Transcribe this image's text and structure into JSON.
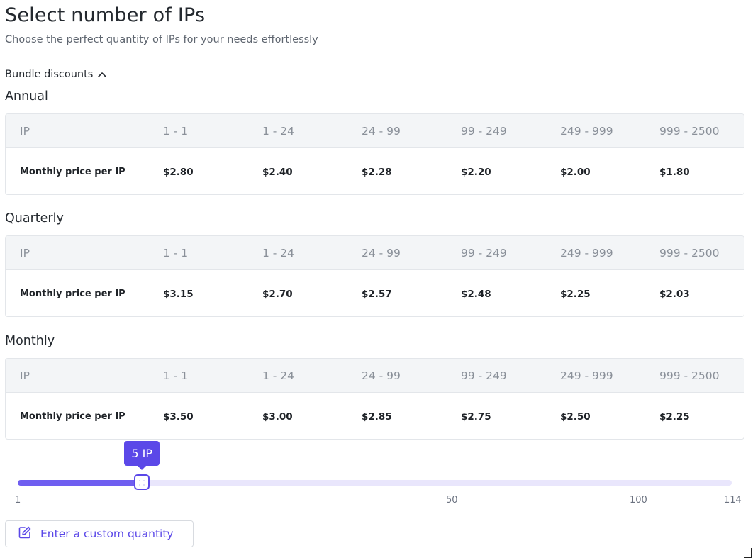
{
  "header": {
    "title": "Select number of IPs",
    "subtitle": "Choose the perfect quantity of IPs for your needs effortlessly",
    "bundle_toggle_label": "Bundle discounts",
    "bundle_toggle_icon": "chevron-up-icon"
  },
  "plans": [
    {
      "name": "Annual",
      "header": [
        "IP",
        "1 - 1",
        "1 - 24",
        "24 - 99",
        "99 - 249",
        "249 - 999",
        "999 - 2500"
      ],
      "row": [
        "Monthly price per IP",
        "$2.80",
        "$2.40",
        "$2.28",
        "$2.20",
        "$2.00",
        "$1.80"
      ]
    },
    {
      "name": "Quarterly",
      "header": [
        "IP",
        "1 - 1",
        "1 - 24",
        "24 - 99",
        "99 - 249",
        "249 - 999",
        "999 - 2500"
      ],
      "row": [
        "Monthly price per IP",
        "$3.15",
        "$2.70",
        "$2.57",
        "$2.48",
        "$2.25",
        "$2.03"
      ]
    },
    {
      "name": "Monthly",
      "header": [
        "IP",
        "1 - 1",
        "1 - 24",
        "24 - 99",
        "99 - 249",
        "249 - 999",
        "999 - 2500"
      ],
      "row": [
        "Monthly price per IP",
        "$3.50",
        "$3.00",
        "$2.85",
        "$2.75",
        "$2.50",
        "$2.25"
      ]
    }
  ],
  "slider": {
    "value": 5,
    "min": 1,
    "max": 114,
    "tooltip": "5 IP",
    "ticks": [
      "1",
      "50",
      "100",
      "114"
    ]
  },
  "custom_button": {
    "label": "Enter a custom quantity",
    "icon": "edit-pencil-icon"
  },
  "colors": {
    "accent": "#5b48e8",
    "track": "#e9e6fc",
    "table_header_bg": "#f3f5f7"
  }
}
